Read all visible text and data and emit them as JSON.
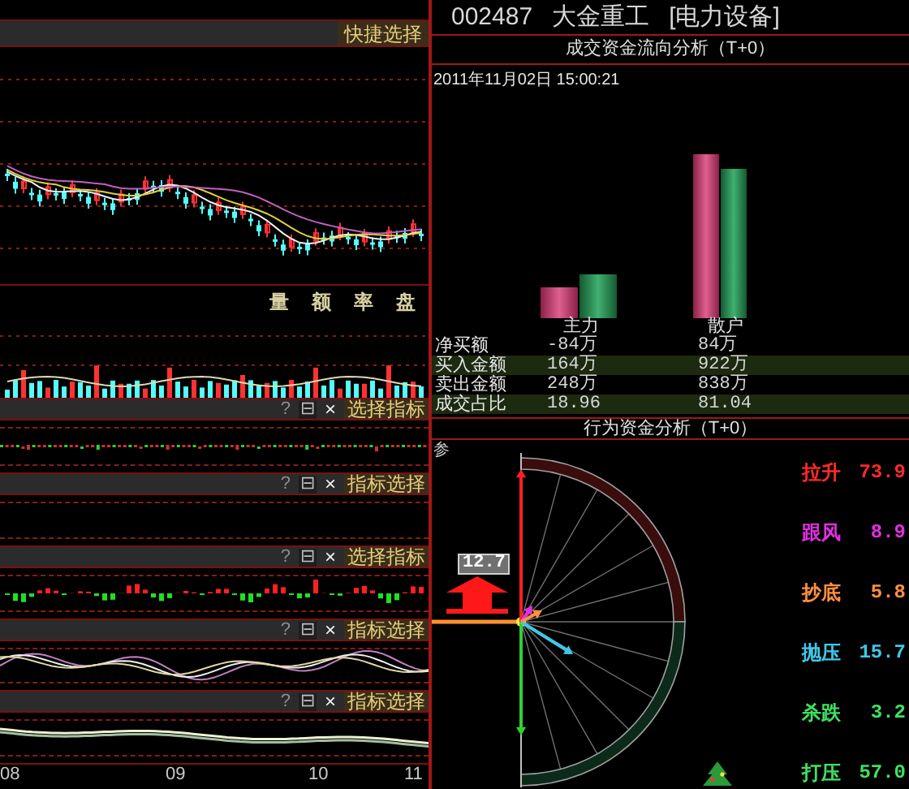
{
  "quick_select": {
    "label": "快捷选择"
  },
  "volume_tabs": [
    "量",
    "额",
    "率",
    "盘"
  ],
  "indicator_panels": [
    {
      "kind": "dots",
      "help": "?",
      "minimize": "⊟",
      "close": "×",
      "select": "选择指标"
    },
    {
      "kind": "empty",
      "help": "?",
      "minimize": "⊟",
      "close": "×",
      "select": "指标选择"
    },
    {
      "kind": "histogram",
      "help": "?",
      "minimize": "⊟",
      "close": "×",
      "select": "选择指标"
    },
    {
      "kind": "waves",
      "help": "?",
      "minimize": "⊟",
      "close": "×",
      "select": "指标选择"
    },
    {
      "kind": "flat",
      "help": "?",
      "minimize": "⊟",
      "close": "×",
      "select": "指标选择"
    }
  ],
  "x_axis": [
    "08",
    "09",
    "10",
    "11"
  ],
  "stock": {
    "code": "002487",
    "name": "大金重工",
    "sector": "[电力设备]"
  },
  "fund_flow": {
    "title": "成交资金流向分析（T+0）",
    "timestamp": "2011年11月02日 15:00:21",
    "groups": [
      "主力",
      "散户"
    ],
    "rows": [
      {
        "label": "净买额",
        "values": [
          "-84万",
          "84万"
        ],
        "highlighted": false
      },
      {
        "label": "买入金额",
        "values": [
          "164万",
          "922万"
        ],
        "highlighted": true
      },
      {
        "label": "卖出金额",
        "values": [
          "248万",
          "838万"
        ],
        "highlighted": false
      },
      {
        "label": "成交占比",
        "values": [
          "18.96",
          "81.04"
        ],
        "highlighted": true
      }
    ]
  },
  "behavior": {
    "title": "行为资金分析（T+0）",
    "side_label": "参",
    "badge": "12.7",
    "legend": [
      {
        "label": "拉升",
        "value": "73.9",
        "color": "#ff2a2a"
      },
      {
        "label": "跟风",
        "value": "8.9",
        "color": "#e030e0"
      },
      {
        "label": "抄底",
        "value": "5.8",
        "color": "#ff9040"
      },
      {
        "label": "抛压",
        "value": "15.7",
        "color": "#40c8e8"
      },
      {
        "label": "杀跌",
        "value": "3.2",
        "color": "#40e060"
      },
      {
        "label": "打压",
        "value": "57.0",
        "color": "#40e060"
      }
    ]
  }
}
